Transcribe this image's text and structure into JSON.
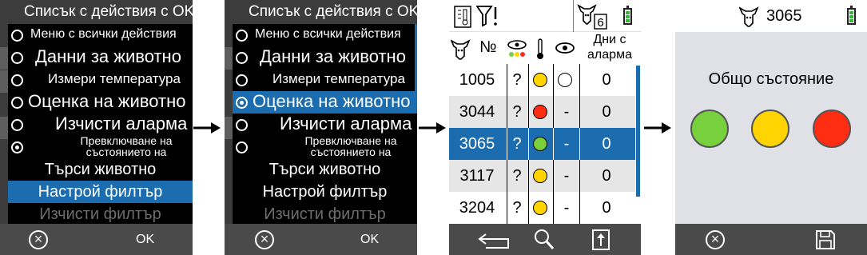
{
  "menu": {
    "title": "Списък с действия с OK:",
    "items": [
      "Меню с всички действия",
      "Данни за животно",
      "Измери температура",
      "Оценка на животно",
      "Изчисти аларма",
      "Превключване на",
      "състоянието на"
    ],
    "search": "Търси животно",
    "filter": "Настрой филтър",
    "clear_filter": "Изчисти филтър",
    "ok": "OK"
  },
  "list": {
    "animal_count": "6",
    "col_number": "№",
    "col_days_1": "Дни с",
    "col_days_2": "аларма",
    "rows": [
      {
        "id": "1005",
        "q": "?",
        "status": "yellow",
        "eye": "circle",
        "days": "0"
      },
      {
        "id": "3044",
        "q": "?",
        "status": "red",
        "eye": "-",
        "days": "0"
      },
      {
        "id": "3065",
        "q": "?",
        "status": "green",
        "eye": "-",
        "days": "0"
      },
      {
        "id": "3117",
        "q": "?",
        "status": "yellow",
        "eye": "-",
        "days": "0"
      },
      {
        "id": "3204",
        "q": "?",
        "status": "yellow",
        "eye": "-",
        "days": "0"
      }
    ]
  },
  "status": {
    "animal_id": "3065",
    "title": "Общо състояние",
    "colors": {
      "green": "#76d13d",
      "yellow": "#ffd400",
      "red": "#ff2d12"
    }
  },
  "colors": {
    "accent": "#1c6cb0",
    "dark": "#3c3c3c",
    "footer": "#4a4a4a",
    "status_bg": "#dfe1e7"
  }
}
